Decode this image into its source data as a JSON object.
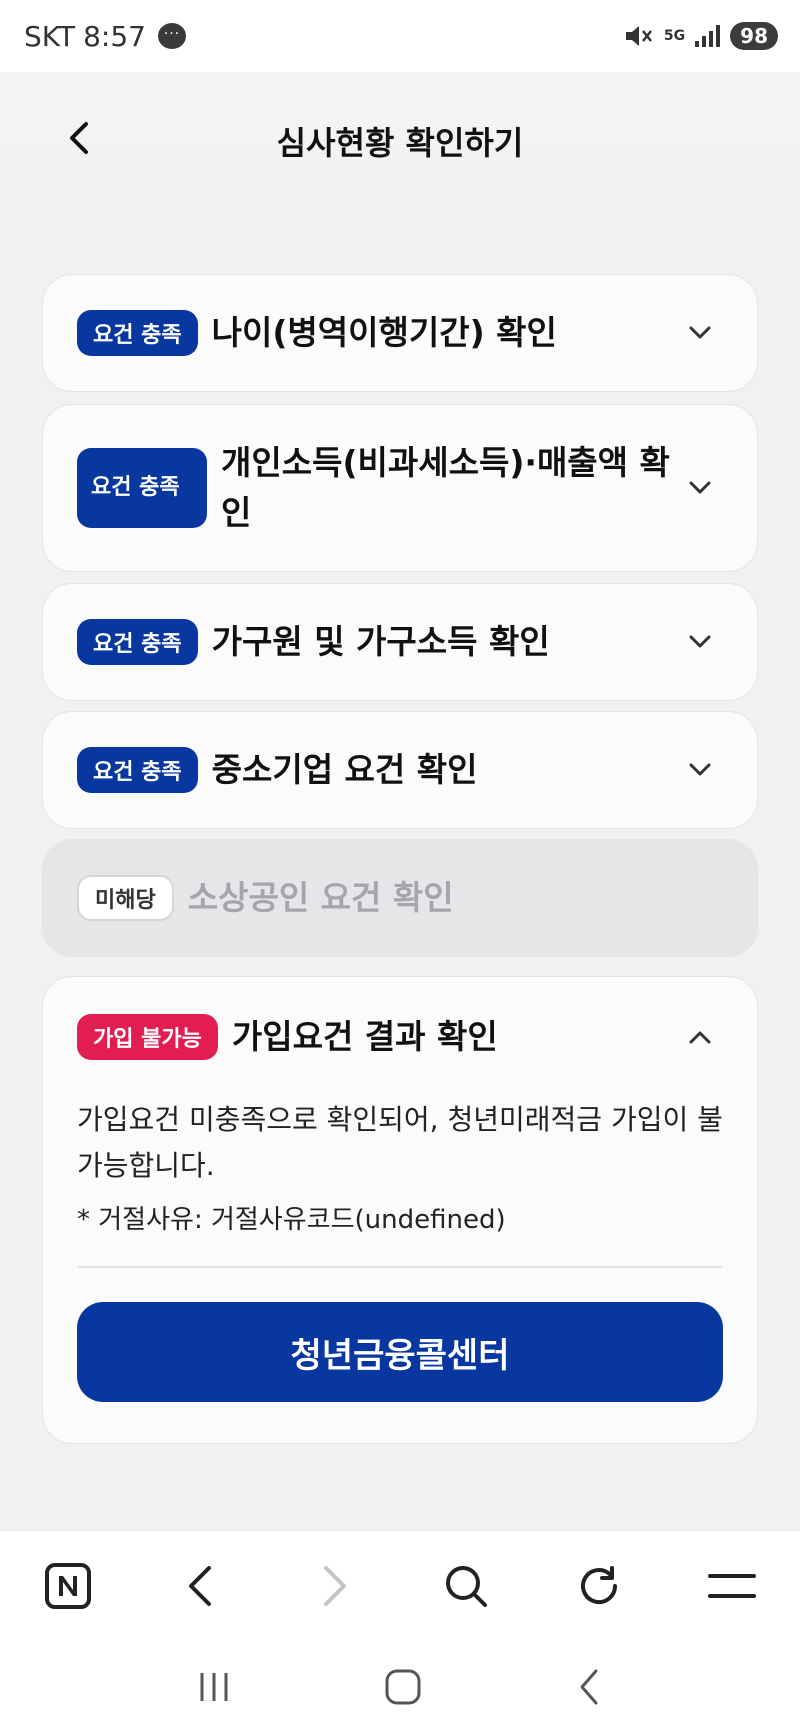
{
  "status_bar": {
    "carrier": "SKT",
    "time": "8:57",
    "network": "5G",
    "battery": "98"
  },
  "header": {
    "title": "심사현황 확인하기"
  },
  "items": [
    {
      "badge": "요건 충족",
      "title": "나이(병역이행기간) 확인",
      "state": "collapsed"
    },
    {
      "badge": "요건 충족",
      "title": "개인소득(비과세소득)·매출액 확인",
      "state": "collapsed"
    },
    {
      "badge": "요건 충족",
      "title": "가구원 및 가구소득 확인",
      "state": "collapsed"
    },
    {
      "badge": "요건 충족",
      "title": "중소기업 요건 확인",
      "state": "collapsed"
    },
    {
      "badge": "미해당",
      "title": "소상공인 요건 확인",
      "state": "disabled"
    }
  ],
  "result": {
    "badge": "가입 불가능",
    "title": "가입요건 결과 확인",
    "message": "가입요건 미충족으로 확인되어, 청년미래적금 가입이 불가능합니다.",
    "reason": "* 거절사유: 거절사유코드(undefined)",
    "cta": "청년금융콜센터"
  },
  "colors": {
    "primary": "#07379f",
    "danger": "#e11d52",
    "background": "#f1f1f3"
  },
  "icons": {
    "browser": [
      "naver-icon",
      "back-arrow-icon",
      "forward-arrow-icon",
      "search-icon",
      "refresh-icon",
      "menu-icon"
    ],
    "system_nav": [
      "recent-apps-icon",
      "home-icon",
      "back-icon"
    ]
  }
}
